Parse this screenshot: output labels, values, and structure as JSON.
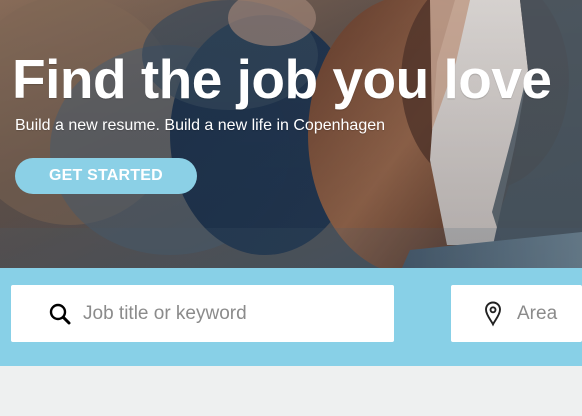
{
  "hero": {
    "title": "Find the job you love",
    "subtitle": "Build a new resume. Build a new life in Copenhagen",
    "cta_label": "GET STARTED"
  },
  "search": {
    "keyword": {
      "icon": "search-icon",
      "placeholder": "Job title or keyword",
      "value": ""
    },
    "area": {
      "icon": "location-pin-icon",
      "placeholder": "Area",
      "value": ""
    }
  },
  "colors": {
    "accent": "#88d0e7",
    "button": "#8bd0e6",
    "page_background": "#eef0f0",
    "input_background": "#ffffff",
    "input_text": "#7e7e7e"
  }
}
